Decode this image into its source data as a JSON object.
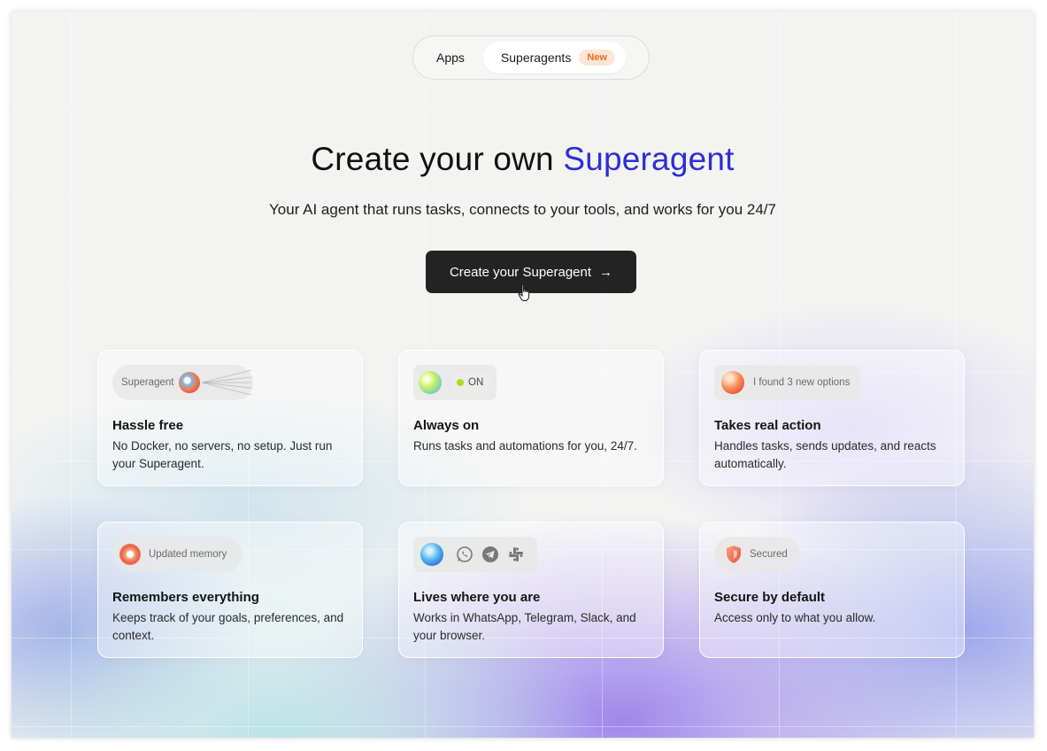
{
  "tabs": [
    {
      "label": "Apps"
    },
    {
      "label": "Superagents",
      "badge": "New"
    }
  ],
  "hero": {
    "title_prefix": "Create your own ",
    "title_accent": "Superagent",
    "subtitle": "Your AI agent that runs tasks, connects to your tools, and works for you 24/7",
    "cta_label": "Create your Superagent",
    "cta_arrow": "→"
  },
  "colors": {
    "accent": "#2b2fd6",
    "cta_bg": "#232323",
    "badge_bg": "#fde6d8",
    "badge_text": "#ea6a1e"
  },
  "cards": [
    {
      "pill_text": "Superagent",
      "title": "Hassle free",
      "desc": "No Docker, no servers, no setup. Just run your Superagent."
    },
    {
      "pill_text": "ON",
      "title": "Always on",
      "desc": "Runs tasks and automations for you, 24/7."
    },
    {
      "pill_text": "I found 3 new options",
      "title": "Takes real action",
      "desc": "Handles tasks, sends updates, and reacts automatically."
    },
    {
      "pill_text": "Updated memory",
      "title": "Remembers everything",
      "desc": "Keeps track of your goals, preferences, and context."
    },
    {
      "pill_text": "",
      "title": "Lives where you are",
      "desc": "Works in WhatsApp, Telegram, Slack, and your browser.",
      "icons": [
        "whatsapp-icon",
        "telegram-icon",
        "slack-icon"
      ]
    },
    {
      "pill_text": "Secured",
      "title": "Secure by default",
      "desc": "Access only to what you allow."
    }
  ]
}
